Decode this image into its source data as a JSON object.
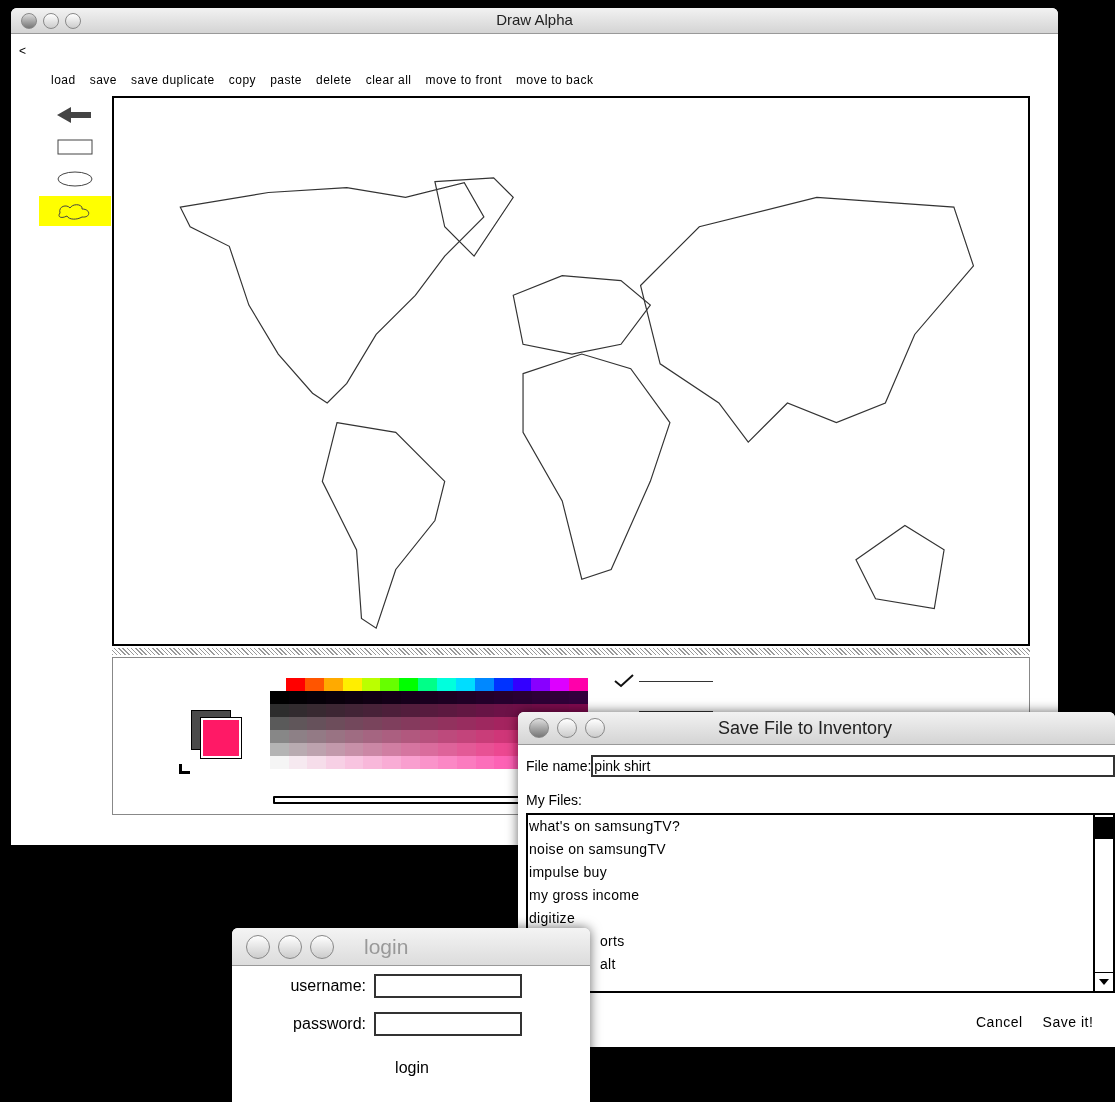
{
  "main_window": {
    "title": "Draw Alpha",
    "back": "<",
    "toolbar": [
      "load",
      "save",
      "save duplicate",
      "copy",
      "paste",
      "delete",
      "clear all",
      "move to front",
      "move to back"
    ],
    "tools": [
      {
        "kind": "arrow",
        "selected": false
      },
      {
        "kind": "rectangle",
        "selected": false
      },
      {
        "kind": "ellipse",
        "selected": false
      },
      {
        "kind": "freeform",
        "selected": true
      }
    ],
    "line_widths": [
      {
        "selected": true
      },
      {
        "selected": false
      }
    ]
  },
  "save_dialog": {
    "title": "Save File to Inventory",
    "file_name_label": "File name:",
    "file_name": "pink shirt",
    "files_label": "My Files:",
    "files": [
      {
        "name": "what's on samsungTV?",
        "kind": "plain"
      },
      {
        "name": "noise on samsungTV",
        "kind": "plain"
      },
      {
        "name": "impulse buy",
        "kind": "plain"
      },
      {
        "name": "my gross income",
        "kind": "plain"
      },
      {
        "name": "digitize",
        "kind": "plain"
      },
      {
        "name": "orts",
        "kind": "covered"
      },
      {
        "name": "alt",
        "kind": "covered"
      }
    ],
    "buttons": [
      "Cancel",
      "Save it!"
    ]
  },
  "login": {
    "title": "login",
    "fields": [
      {
        "label": "username:"
      },
      {
        "label": "password:"
      }
    ],
    "button": "login"
  }
}
